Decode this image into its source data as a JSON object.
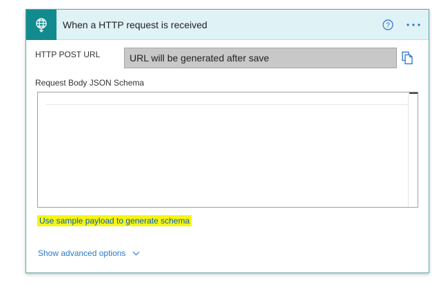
{
  "header": {
    "title": "When a HTTP request is received",
    "trigger_icon": "globe-request-icon",
    "help_icon": "help-circle-icon",
    "more_icon": "more-options-icon"
  },
  "url_section": {
    "label": "HTTP POST URL",
    "value": "URL will be generated after save",
    "copy_icon": "copy-icon"
  },
  "schema_section": {
    "label": "Request Body JSON Schema",
    "value": ""
  },
  "links": {
    "sample_payload": "Use sample payload to generate schema",
    "advanced_options": "Show advanced options"
  },
  "colors": {
    "header_bg": "#dff2f6",
    "icon_bg": "#128b8f",
    "card_border": "#5aa7a7",
    "url_field_bg": "#c8c8c8",
    "link": "#0a5dbd",
    "highlight": "#f5f514"
  }
}
